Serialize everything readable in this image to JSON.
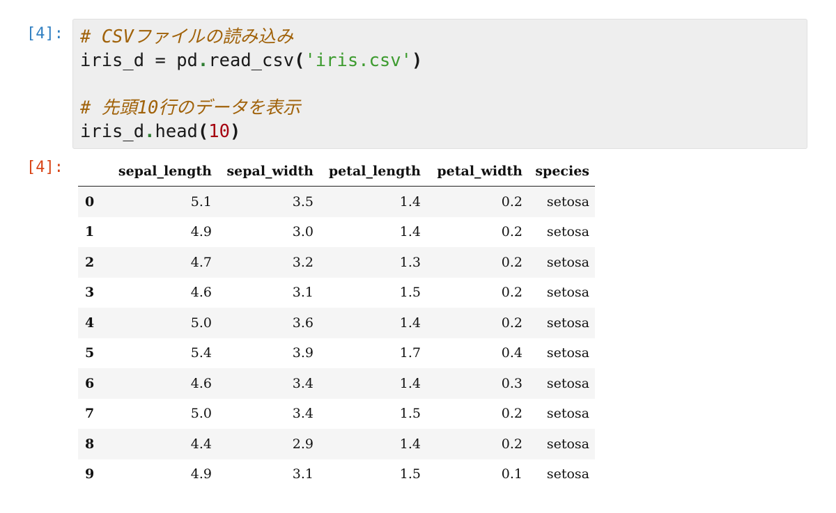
{
  "cell": {
    "in_prompt": "[4]:",
    "out_prompt": "[4]:",
    "code": {
      "comment1": "# CSVファイルの読み込み",
      "line2_var": "iris_d",
      "line2_eq": " = ",
      "line2_obj": "pd",
      "line2_dot": ".",
      "line2_fn": "read_csv",
      "line2_open": "(",
      "line2_str": "'iris.csv'",
      "line2_close": ")",
      "comment2": "# 先頭10行のデータを表示",
      "line5_obj": "iris_d",
      "line5_dot": ".",
      "line5_fn": "head",
      "line5_open": "(",
      "line5_num": "10",
      "line5_close": ")"
    }
  },
  "dataframe": {
    "columns": [
      "sepal_length",
      "sepal_width",
      "petal_length",
      "petal_width",
      "species"
    ],
    "rows": [
      {
        "index": "0",
        "values": [
          "5.1",
          "3.5",
          "1.4",
          "0.2",
          "setosa"
        ]
      },
      {
        "index": "1",
        "values": [
          "4.9",
          "3.0",
          "1.4",
          "0.2",
          "setosa"
        ]
      },
      {
        "index": "2",
        "values": [
          "4.7",
          "3.2",
          "1.3",
          "0.2",
          "setosa"
        ]
      },
      {
        "index": "3",
        "values": [
          "4.6",
          "3.1",
          "1.5",
          "0.2",
          "setosa"
        ]
      },
      {
        "index": "4",
        "values": [
          "5.0",
          "3.6",
          "1.4",
          "0.2",
          "setosa"
        ]
      },
      {
        "index": "5",
        "values": [
          "5.4",
          "3.9",
          "1.7",
          "0.4",
          "setosa"
        ]
      },
      {
        "index": "6",
        "values": [
          "4.6",
          "3.4",
          "1.4",
          "0.3",
          "setosa"
        ]
      },
      {
        "index": "7",
        "values": [
          "5.0",
          "3.4",
          "1.5",
          "0.2",
          "setosa"
        ]
      },
      {
        "index": "8",
        "values": [
          "4.4",
          "2.9",
          "1.4",
          "0.2",
          "setosa"
        ]
      },
      {
        "index": "9",
        "values": [
          "4.9",
          "3.1",
          "1.5",
          "0.1",
          "setosa"
        ]
      }
    ]
  },
  "colors": {
    "in_prompt": "#307fc1",
    "out_prompt": "#d84315",
    "comment": "#a0620a",
    "string": "#3d9b2f",
    "number": "#a5000f",
    "input_background": "#eeeeee"
  }
}
